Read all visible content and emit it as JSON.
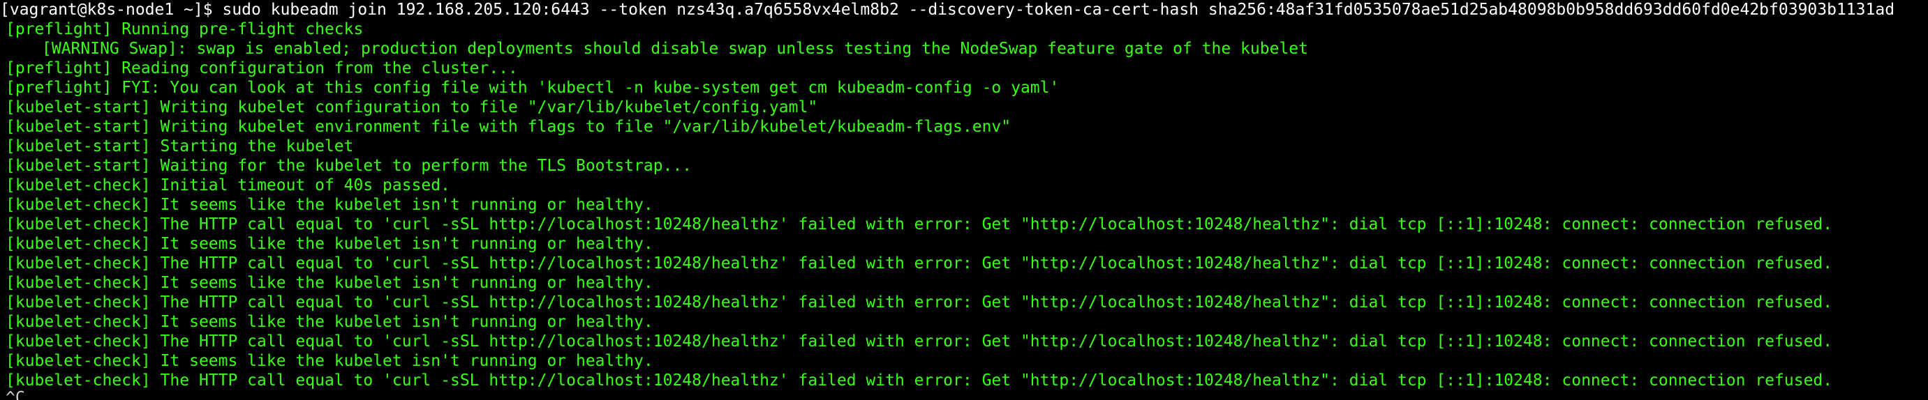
{
  "terminal": {
    "lines": [
      "[vagrant@k8s-node1 ~]$ sudo kubeadm join 192.168.205.120:6443 --token nzs43q.a7q6558vx4elm8b2 --discovery-token-ca-cert-hash sha256:48af31fd0535078ae51d25ab48098b0b958dd693dd60fd0e42bf03903b1131ad",
      "[preflight] Running pre-flight checks",
      "[WARNING Swap]: swap is enabled; production deployments should disable swap unless testing the NodeSwap feature gate of the kubelet",
      "[preflight] Reading configuration from the cluster...",
      "[preflight] FYI: You can look at this config file with 'kubectl -n kube-system get cm kubeadm-config -o yaml'",
      "[kubelet-start] Writing kubelet configuration to file \"/var/lib/kubelet/config.yaml\"",
      "[kubelet-start] Writing kubelet environment file with flags to file \"/var/lib/kubelet/kubeadm-flags.env\"",
      "[kubelet-start] Starting the kubelet",
      "[kubelet-start] Waiting for the kubelet to perform the TLS Bootstrap...",
      "[kubelet-check] Initial timeout of 40s passed.",
      "[kubelet-check] It seems like the kubelet isn't running or healthy.",
      "[kubelet-check] The HTTP call equal to 'curl -sSL http://localhost:10248/healthz' failed with error: Get \"http://localhost:10248/healthz\": dial tcp [::1]:10248: connect: connection refused.",
      "[kubelet-check] It seems like the kubelet isn't running or healthy.",
      "[kubelet-check] The HTTP call equal to 'curl -sSL http://localhost:10248/healthz' failed with error: Get \"http://localhost:10248/healthz\": dial tcp [::1]:10248: connect: connection refused.",
      "[kubelet-check] It seems like the kubelet isn't running or healthy.",
      "[kubelet-check] The HTTP call equal to 'curl -sSL http://localhost:10248/healthz' failed with error: Get \"http://localhost:10248/healthz\": dial tcp [::1]:10248: connect: connection refused.",
      "[kubelet-check] It seems like the kubelet isn't running or healthy.",
      "[kubelet-check] The HTTP call equal to 'curl -sSL http://localhost:10248/healthz' failed with error: Get \"http://localhost:10248/healthz\": dial tcp [::1]:10248: connect: connection refused.",
      "[kubelet-check] It seems like the kubelet isn't running or healthy.",
      "[kubelet-check] The HTTP call equal to 'curl -sSL http://localhost:10248/healthz' failed with error: Get \"http://localhost:10248/healthz\": dial tcp [::1]:10248: connect: connection refused.",
      "^C"
    ]
  },
  "colors": {
    "background": "#000000",
    "output_text": "#39ff14",
    "prompt_text": "#ffffff"
  }
}
